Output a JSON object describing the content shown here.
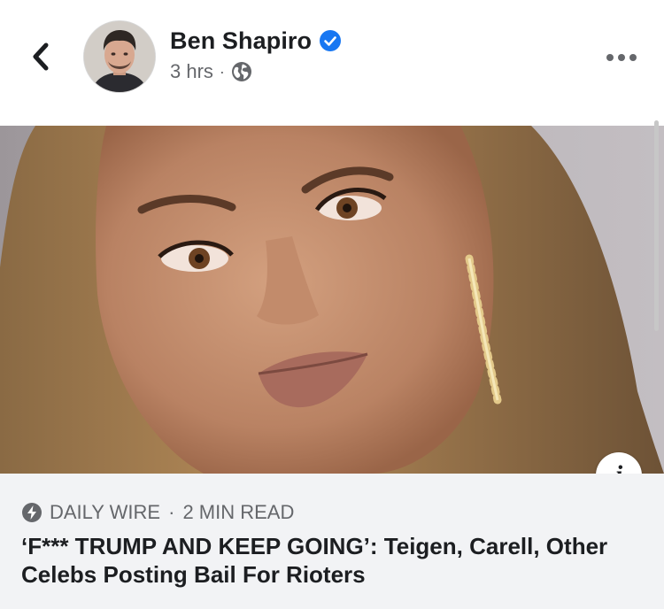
{
  "header": {
    "back_icon": "chevron-left-icon",
    "author_name": "Ben Shapiro",
    "verified_icon": "verified-badge-icon",
    "verified_color": "#1877f2",
    "timestamp": "3 hrs",
    "separator": "·",
    "privacy_icon": "globe-icon",
    "more_icon": "more-horizontal-icon"
  },
  "post": {
    "image_description_icon": "photo",
    "info_label": "i"
  },
  "link": {
    "source_icon": "lightning-bolt-icon",
    "source": "DAILY WIRE",
    "separator": "·",
    "read_time": "2 MIN READ",
    "headline": "‘F*** TRUMP AND KEEP GOING’: Teigen, Carell, Other Celebs Posting Bail For Rioters"
  },
  "colors": {
    "text_primary": "#1c1e21",
    "text_secondary": "#65676b",
    "card_background": "#f2f3f5"
  }
}
